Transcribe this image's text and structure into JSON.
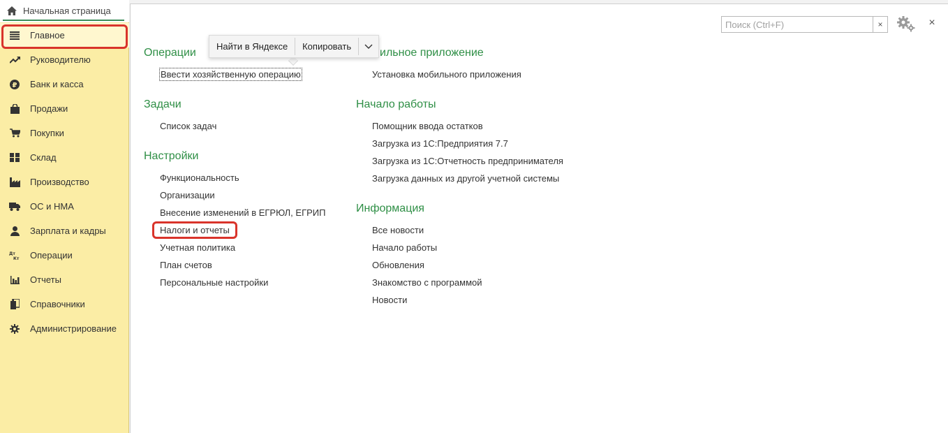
{
  "home_tab": {
    "label": "Начальная страница",
    "icon": "home-icon"
  },
  "sidebar": {
    "items": [
      {
        "label": "Главное",
        "icon": "menu-lines-icon",
        "active": true
      },
      {
        "label": "Руководителю",
        "icon": "trend-up-icon"
      },
      {
        "label": "Банк и касса",
        "icon": "ruble-icon"
      },
      {
        "label": "Продажи",
        "icon": "shopping-bag-icon"
      },
      {
        "label": "Покупки",
        "icon": "cart-icon"
      },
      {
        "label": "Склад",
        "icon": "warehouse-grid-icon"
      },
      {
        "label": "Производство",
        "icon": "factory-icon"
      },
      {
        "label": "ОС и НМА",
        "icon": "truck-icon"
      },
      {
        "label": "Зарплата и кадры",
        "icon": "person-icon"
      },
      {
        "label": "Операции",
        "icon": "debit-credit-icon",
        "icon_text_top": "Дт",
        "icon_text_bottom": "Кт"
      },
      {
        "label": "Отчеты",
        "icon": "bar-chart-icon"
      },
      {
        "label": "Справочники",
        "icon": "books-icon"
      },
      {
        "label": "Администрирование",
        "icon": "gear-icon"
      }
    ]
  },
  "search": {
    "placeholder": "Поиск (Ctrl+F)",
    "clear_label": "×"
  },
  "header_controls": {
    "settings_icon": "gears-icon",
    "close_label": "×"
  },
  "popup": {
    "find_label": "Найти в Яндексе",
    "copy_label": "Копировать",
    "expand_icon": "chevron-down-icon"
  },
  "sections": {
    "operations": {
      "title": "Операции",
      "links": [
        "Ввести хозяйственную операцию"
      ]
    },
    "tasks": {
      "title": "Задачи",
      "links": [
        "Список задач"
      ]
    },
    "settings": {
      "title": "Настройки",
      "links": [
        "Функциональность",
        "Организации",
        "Внесение изменений в ЕГРЮЛ, ЕГРИП",
        "Налоги и отчеты",
        "Учетная политика",
        "План счетов",
        "Персональные настройки"
      ]
    },
    "mobile": {
      "title": "ильное приложение",
      "links": [
        "Установка мобильного приложения"
      ]
    },
    "start": {
      "title": "Начало работы",
      "links": [
        "Помощник ввода остатков",
        "Загрузка из 1С:Предприятия 7.7",
        "Загрузка из 1С:Отчетность предпринимателя",
        "Загрузка данных из другой учетной системы"
      ]
    },
    "info": {
      "title": "Информация",
      "links": [
        "Все новости",
        "Начало работы",
        "Обновления",
        "Знакомство с программой",
        "Новости"
      ]
    }
  },
  "colors": {
    "sidebar_bg": "#fbeda5",
    "section_title": "#2f8f46",
    "highlight_red": "#d9342b",
    "tab_underline": "#3b8d5a"
  }
}
